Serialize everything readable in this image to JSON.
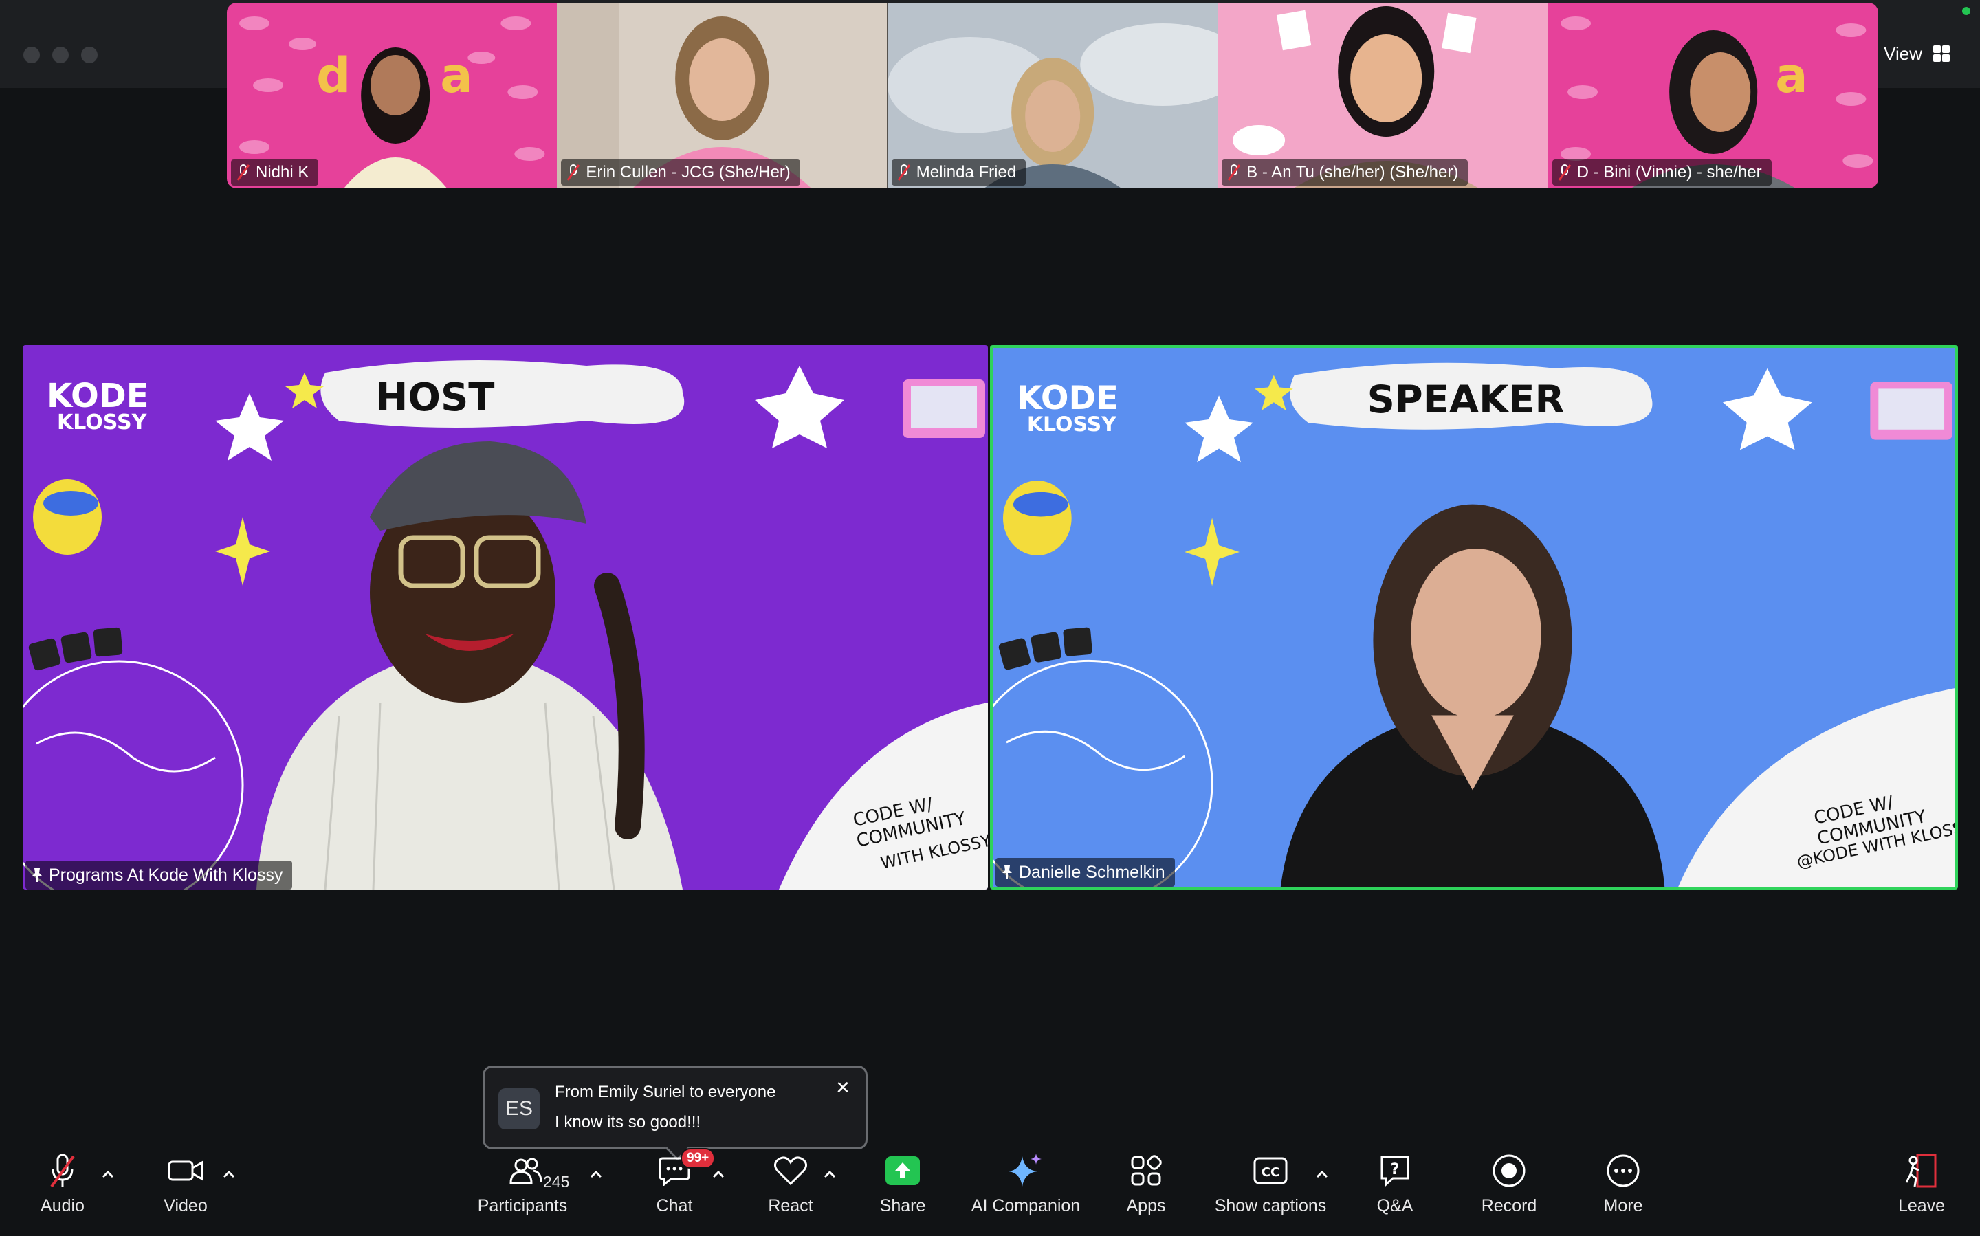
{
  "window": {
    "view_label": "View"
  },
  "gallery": [
    {
      "name": "Nidhi K",
      "bg": "#e6419a"
    },
    {
      "name": "Erin Cullen - JCG (She/Her)",
      "bg": "#d9cfc4"
    },
    {
      "name": "Melinda Fried",
      "bg": "#b9c2cb"
    },
    {
      "name": "B - An Tu (she/her) (She/her)",
      "bg": "#f3a6c8"
    },
    {
      "name": "D - Bini (Vinnie) - she/her",
      "bg": "#e6419a"
    }
  ],
  "tiles": {
    "host": {
      "banner": "HOST",
      "brand_line1": "KODE",
      "brand_line2": "KLOSSY",
      "corner_text1": "CODE W/",
      "corner_text2": "COMMUNITY",
      "corner_text3": "WITH KLOSSY",
      "name": "Programs At Kode With Klossy",
      "bg": "#7d2ad0"
    },
    "speaker": {
      "banner": "SPEAKER",
      "brand_line1": "KODE",
      "brand_line2": "KLOSSY",
      "corner_text1": "CODE W/",
      "corner_text2": "COMMUNITY",
      "corner_text3": "@KODE WITH KLOSSY",
      "name": "Danielle Schmelkin",
      "bg": "#5b8ff0",
      "active_color": "#2fd35b"
    }
  },
  "chat_toast": {
    "initials": "ES",
    "from": "From Emily Suriel to everyone",
    "message": "I know its so good!!!"
  },
  "toolbar": {
    "audio": "Audio",
    "video": "Video",
    "participants": "Participants",
    "participants_count": "245",
    "chat": "Chat",
    "chat_badge": "99+",
    "react": "React",
    "share": "Share",
    "ai_companion": "AI Companion",
    "apps": "Apps",
    "show_captions": "Show captions",
    "qa": "Q&A",
    "record": "Record",
    "more": "More",
    "leave": "Leave"
  },
  "colors": {
    "share_green": "#23c552",
    "badge_red": "#e02f3c",
    "leave_red": "#e02f3c"
  }
}
